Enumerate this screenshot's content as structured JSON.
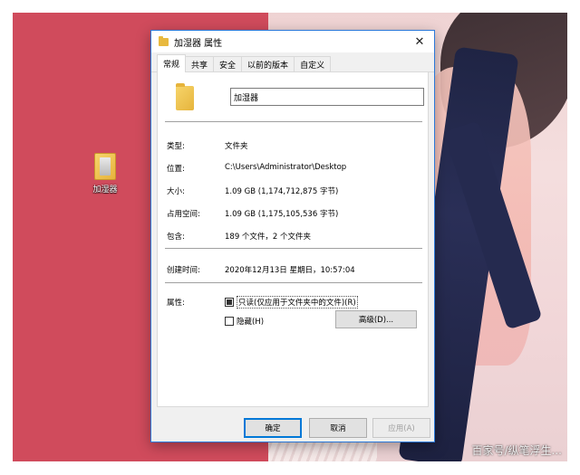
{
  "desktop": {
    "icon_label": "加湿器",
    "watermark": "百家号/纵笔浮生..."
  },
  "dialog": {
    "title": "加湿器 属性",
    "close_symbol": "✕",
    "tabs": [
      {
        "label": "常规",
        "active": true
      },
      {
        "label": "共享"
      },
      {
        "label": "安全"
      },
      {
        "label": "以前的版本"
      },
      {
        "label": "自定义"
      }
    ],
    "name_value": "加湿器",
    "fields": {
      "type_label": "类型:",
      "type_value": "文件夹",
      "location_label": "位置:",
      "location_value": "C:\\Users\\Administrator\\Desktop",
      "size_label": "大小:",
      "size_value": "1.09 GB (1,174,712,875 字节)",
      "disk_label": "占用空间:",
      "disk_value": "1.09 GB (1,175,105,536 字节)",
      "contains_label": "包含:",
      "contains_value": "189 个文件，2 个文件夹",
      "created_label": "创建时间:",
      "created_value": "2020年12月13日 星期日，10:57:04",
      "attributes_label": "属性:"
    },
    "attributes": {
      "readonly_label": "只读(仅应用于文件夹中的文件)(R)",
      "hidden_label": "隐藏(H)",
      "advanced_label": "高级(D)..."
    },
    "buttons": {
      "ok": "确定",
      "cancel": "取消",
      "apply": "应用(A)"
    }
  }
}
